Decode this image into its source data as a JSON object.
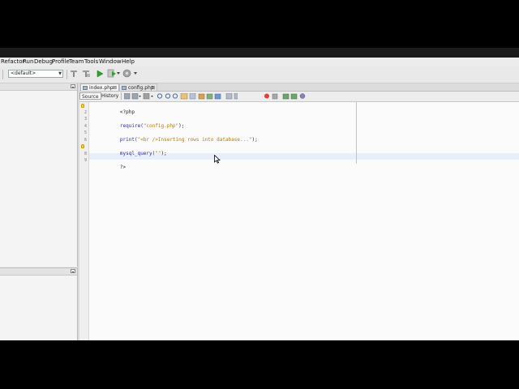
{
  "menubar": {
    "items": [
      "Refactor",
      "Run",
      "Debug",
      "Profile",
      "Team",
      "Tools",
      "Window",
      "Help"
    ]
  },
  "toolbar": {
    "config_value": "<default>"
  },
  "editor": {
    "tabs": [
      {
        "label": "index.php",
        "active": true
      },
      {
        "label": "config.php",
        "active": false
      }
    ],
    "view_tabs": {
      "source": "Source",
      "history": "History"
    },
    "line_numbers": [
      "1",
      "2",
      "3",
      "4",
      "5",
      "6",
      "7",
      "8",
      "9"
    ],
    "code": {
      "line1": "<?php",
      "line3_fn": "require(",
      "line3_str": "\"config.php\"",
      "line3_end": ");",
      "line5_fn": "print(",
      "line5_str": "\"<br />Inserting rows into database...\"",
      "line5_end": ");",
      "line7_fn": "mysql_query(",
      "line7_str": "\"\"",
      "line7_end": ");",
      "line9": "?>"
    }
  },
  "colors": {
    "keyword": "#2a2aa0",
    "string": "#b07a18",
    "hint_bulb": "#f3d43b"
  }
}
